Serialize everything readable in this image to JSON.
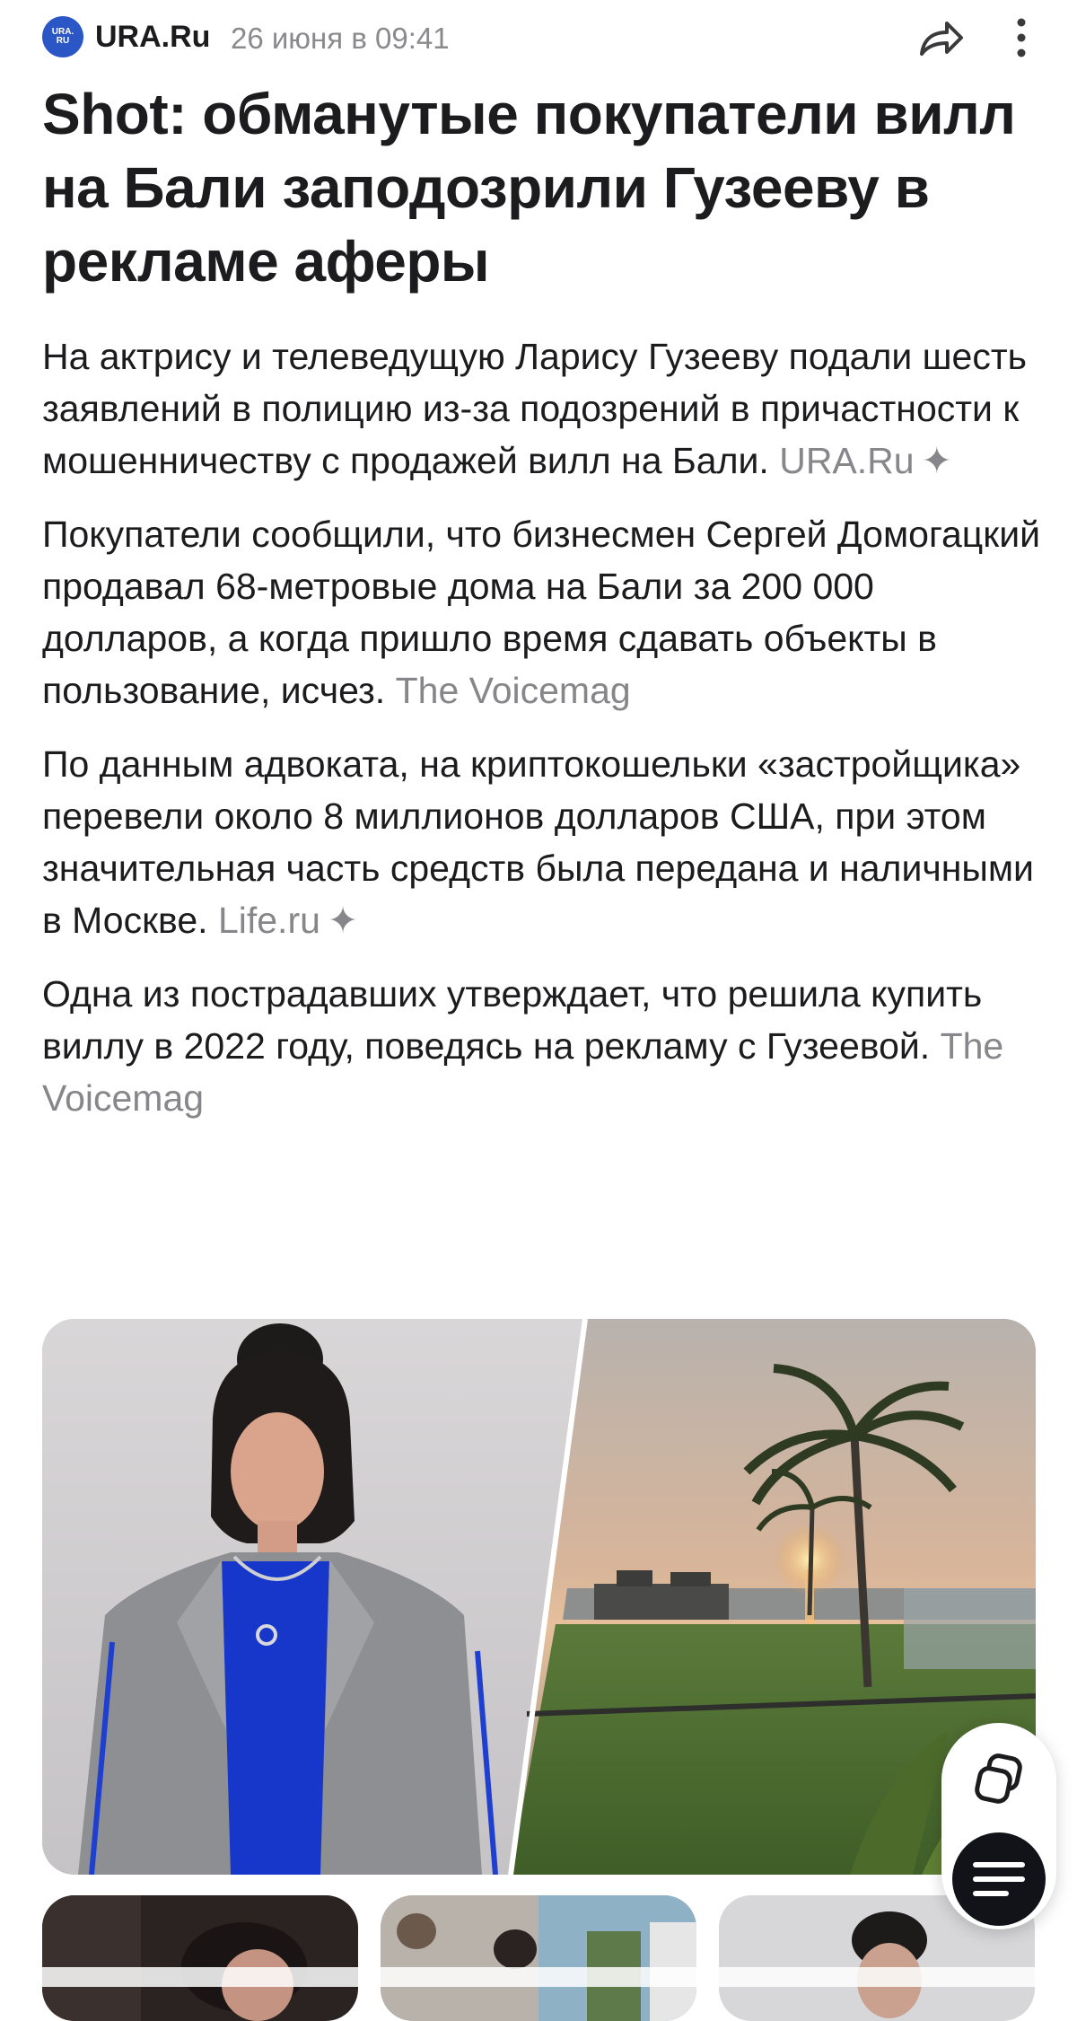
{
  "header": {
    "logo_text_top": "URA.",
    "logo_text_bottom": "RU",
    "source": "URA.Ru",
    "timestamp": "26 июня в 09:41",
    "share_icon": "share-arrow-icon",
    "menu_icon": "more-vertical-icon"
  },
  "article": {
    "title": "Shot: обманутые покупатели вилл на Бали заподозрили Гузееву в рекламе аферы",
    "paragraphs": [
      {
        "text": "На актрису и телеведущую Ларису Гузееву подали шесть заявлений в полицию из-за подозрений в причастности к мошенничеству с продажей вилл на Бали.",
        "source": "URA.Ru",
        "sparkle": "✦"
      },
      {
        "text": "Покупатели сообщили, что бизнесмен Сергей Домогацкий продавал 68-метровые дома на Бали за 200 000 долларов, а когда пришло время сдавать объекты в пользование, исчез.",
        "source": "The Voicemag",
        "sparkle": ""
      },
      {
        "text": "По данным адвоката, на криптокошельки «застройщика» перевели около 8 миллионов долларов США, при этом значительная часть средств была передана и наличными в Москве.",
        "source": "Life.ru",
        "sparkle": "✦"
      },
      {
        "text": "Одна из пострадавших утверждает, что решила купить виллу в 2022 году, поведясь на рекламу с Гузеевой.",
        "source": "The Voicemag",
        "sparkle": ""
      }
    ]
  },
  "fab": {
    "copy_icon": "copy-icon",
    "menu_icon": "text-lines-icon"
  },
  "colors": {
    "text": "#1c1c1e",
    "secondary": "#86868b",
    "logo": "#2a56c6",
    "fab_dark": "#111318"
  }
}
